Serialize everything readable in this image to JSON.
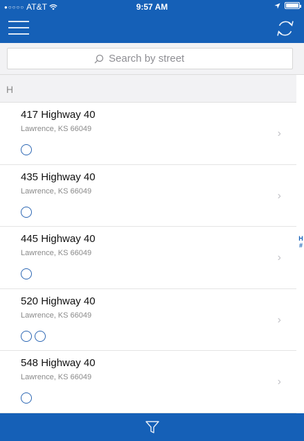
{
  "status_bar": {
    "carrier": "AT&T",
    "signal_dots": "●○○○○",
    "time": "9:57 AM"
  },
  "search": {
    "placeholder": "Search by street"
  },
  "section": {
    "header": "H"
  },
  "addresses": [
    {
      "street": "417 Highway 40",
      "city": "Lawrence, KS 66049",
      "circles": 1
    },
    {
      "street": "435 Highway 40",
      "city": "Lawrence, KS 66049",
      "circles": 1
    },
    {
      "street": "445 Highway 40",
      "city": "Lawrence, KS 66049",
      "circles": 1
    },
    {
      "street": "520 Highway 40",
      "city": "Lawrence, KS 66049",
      "circles": 2
    },
    {
      "street": "548 Highway 40",
      "city": "Lawrence, KS 66049",
      "circles": 1
    }
  ],
  "index_bar": [
    "H",
    "#"
  ],
  "icons": {
    "menu": "hamburger-menu-icon",
    "refresh": "refresh-icon",
    "search": "search-icon",
    "filter": "filter-icon",
    "chevron": "chevron-right-icon",
    "wifi": "wifi-icon",
    "location": "location-arrow-icon",
    "battery": "battery-icon",
    "status_circle": "circle-icon"
  },
  "colors": {
    "brand": "#1560b7",
    "background": "#f2f2f4",
    "circle": "#2b66b3"
  }
}
